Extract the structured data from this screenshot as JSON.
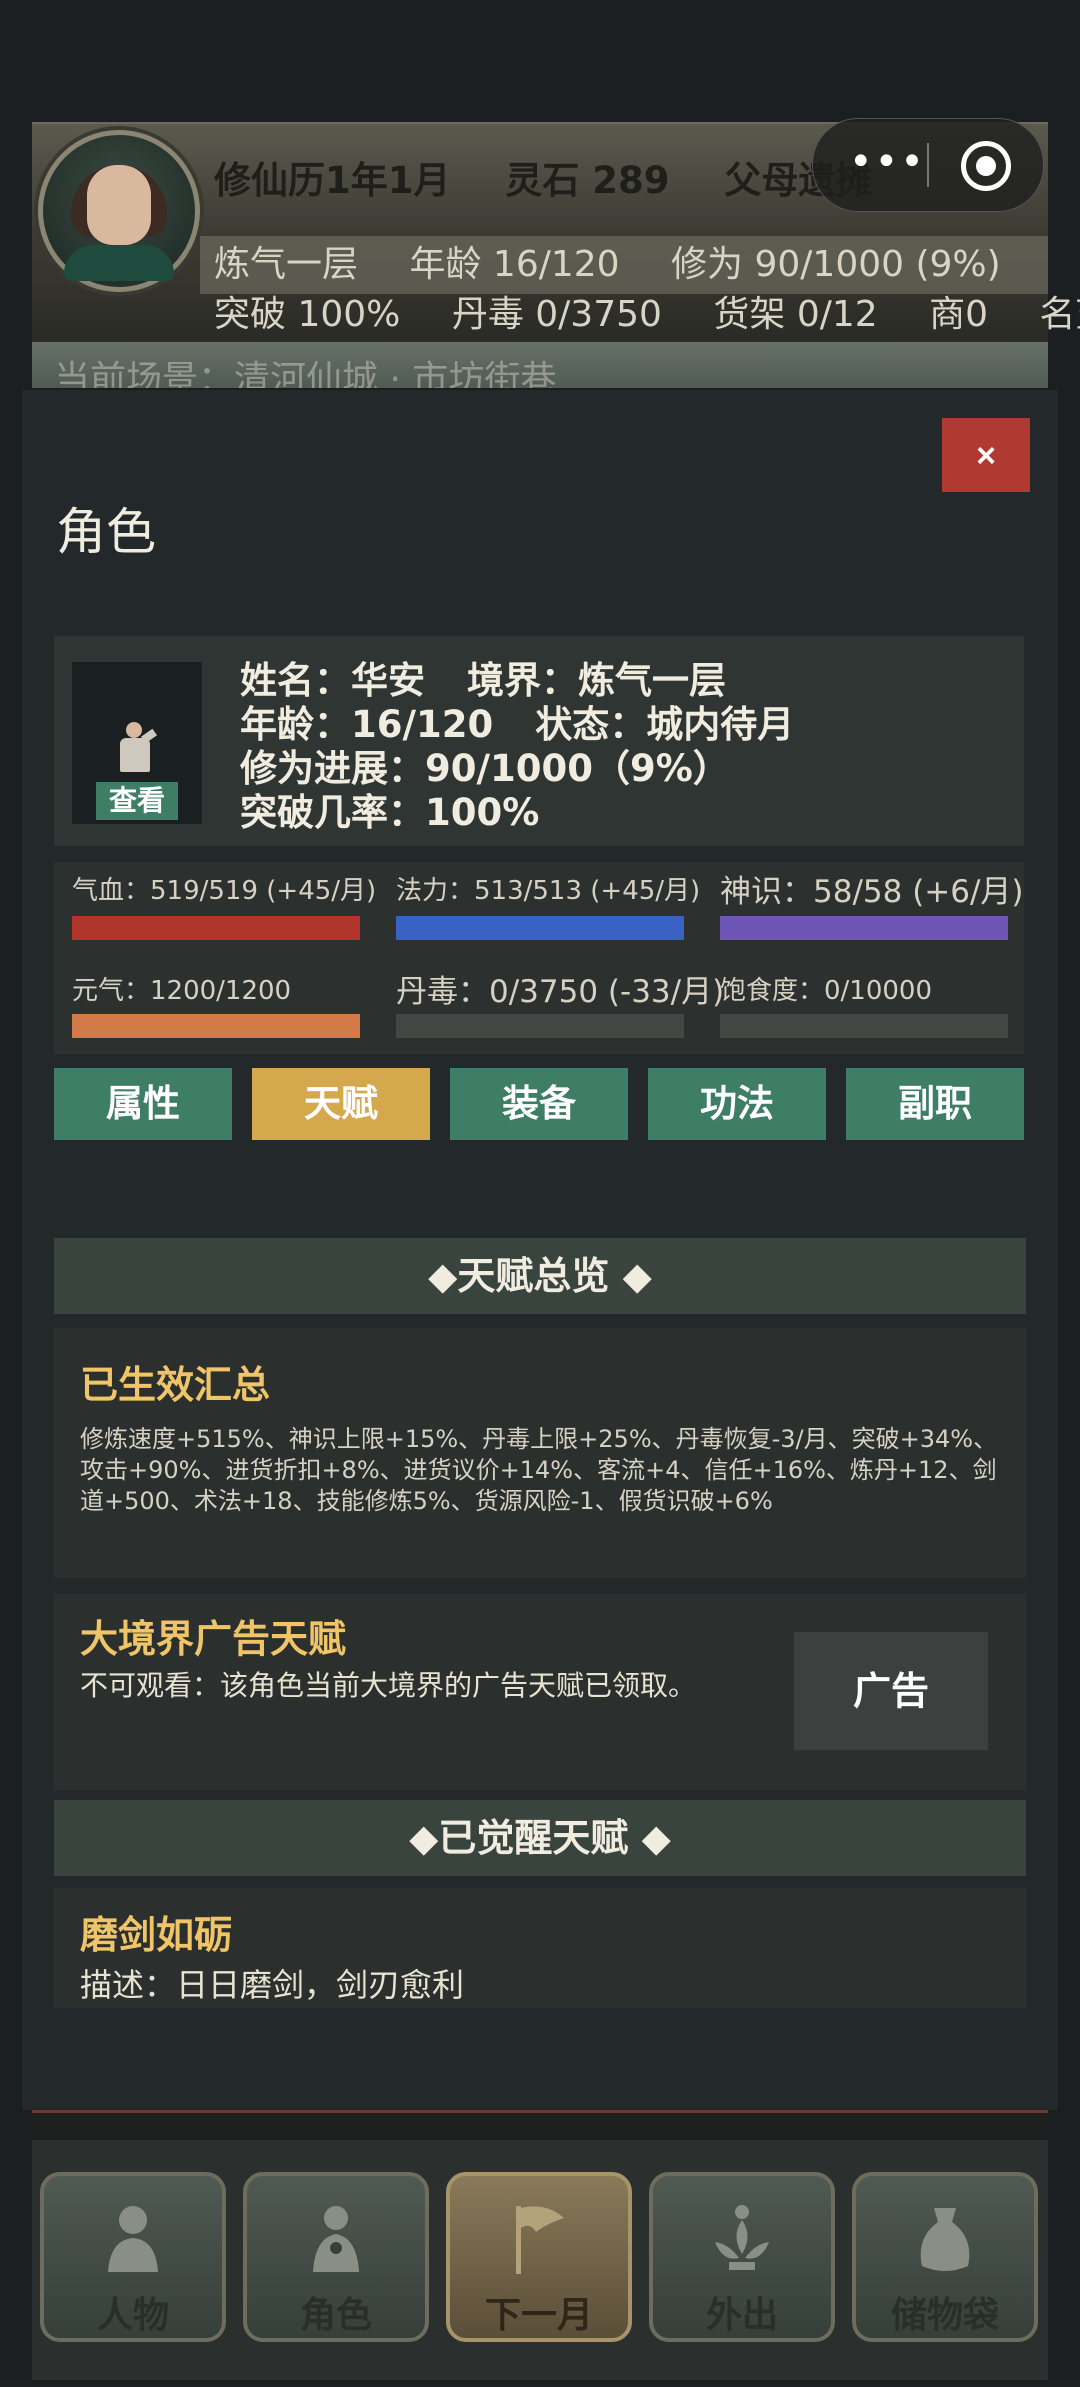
{
  "header": {
    "date": "修仙历1年1月",
    "spirit_stones": "灵石 289",
    "location": "父母遗摊",
    "realm": "炼气一层",
    "age": "年龄 16/120",
    "cultivation": "修为 90/1000 (9%)",
    "breakthrough": "突破 100%",
    "toxicity": "丹毒 0/3750",
    "shelf": "货架 0/12",
    "merchant": "商0",
    "fame": "名望",
    "scene_text": "当前场景：清河仙城 · 市坊街巷"
  },
  "modal": {
    "close_label": "×",
    "title": "角色",
    "character": {
      "view_label": "查看",
      "name_label": "姓名：华安",
      "realm_label": "境界：炼气一层",
      "age_label": "年龄：16/120",
      "status_label": "状态：城内待月",
      "progress_label": "修为进展：90/1000（9%）",
      "breakthrough_label": "突破几率：100%"
    },
    "stats": {
      "hp": {
        "label": "气血：519/519 (+45/月)",
        "fill": 1.0,
        "color": "#b2352c"
      },
      "mana": {
        "label": "法力：513/513 (+45/月)",
        "fill": 1.0,
        "color": "#3a62c4"
      },
      "spirit": {
        "label": "神识：58/58 (+6/月)",
        "fill": 1.0,
        "color": "#6c55b4"
      },
      "vitality": {
        "label": "元气：1200/1200",
        "fill": 1.0,
        "color": "#d27a48"
      },
      "toxicity": {
        "label": "丹毒：0/3750 (-33/月)",
        "fill": 0.0,
        "color": "#7a7f7a"
      },
      "satiety": {
        "label": "饱食度：0/10000",
        "fill": 0.0,
        "color": "#7a7f7a"
      }
    },
    "tabs": [
      {
        "label": "属性",
        "active": false
      },
      {
        "label": "天赋",
        "active": true
      },
      {
        "label": "装备",
        "active": false
      },
      {
        "label": "功法",
        "active": false
      },
      {
        "label": "副职",
        "active": false
      }
    ],
    "talent_overview_header": "◆天赋总览 ◆",
    "summary": {
      "title": "已生效汇总",
      "text": "修炼速度+515%、神识上限+15%、丹毒上限+25%、丹毒恢复-3/月、突破+34%、攻击+90%、进货折扣+8%、进货议价+14%、客流+4、信任+16%、炼丹+12、剑道+500、术法+18、技能修炼5%、货源风险-1、假货识破+6%"
    },
    "ad_talent": {
      "title": "大境界广告天赋",
      "text": "不可观看：该角色当前大境界的广告天赋已领取。",
      "button_label": "广告"
    },
    "awakened_header": "◆已觉醒天赋 ◆",
    "talent": {
      "name": "磨剑如砺",
      "desc": "描述：日日磨剑，剑刃愈利"
    }
  },
  "nav": [
    {
      "label": "人物",
      "icon": "person-icon"
    },
    {
      "label": "角色",
      "icon": "character-icon"
    },
    {
      "label": "下一月",
      "icon": "flag-icon"
    },
    {
      "label": "外出",
      "icon": "lotus-icon"
    },
    {
      "label": "储物袋",
      "icon": "bag-icon"
    }
  ]
}
